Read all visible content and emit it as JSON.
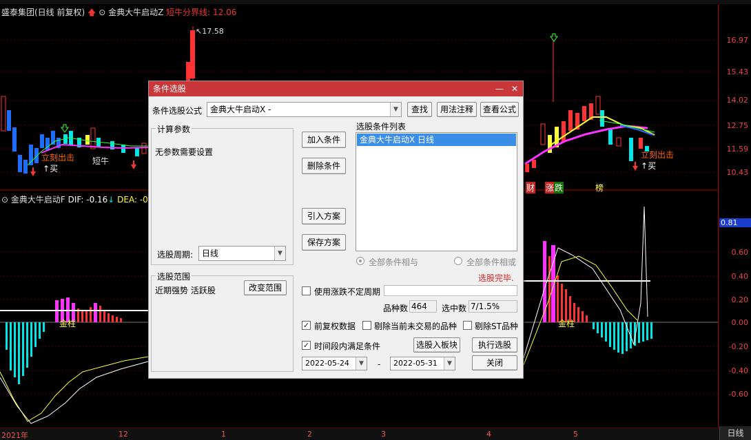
{
  "chart": {
    "stock_title": "盛泰集团(日线 前复权)",
    "indicator_main": "金典大牛启动Z",
    "bull_line_label": "短牛分界线: 12.06",
    "price_axis": [
      "16.97",
      "15.43",
      "14.02",
      "12.75",
      "11.59",
      "10.43"
    ],
    "high_marker": "17.58",
    "sub_axis": [
      "0.81",
      "0.60",
      "0.40",
      "0.20",
      "0.00",
      "-0.20",
      "-0.40",
      "-0.60"
    ],
    "sub_indicator": "金典大牛启动F",
    "dif_label": "DIF: -0.16",
    "dea_label": "DEA: -0.",
    "time_axis": [
      "2021年",
      "12",
      "1",
      "2",
      "3",
      "4",
      "5"
    ],
    "period_button": "日线",
    "annotations": {
      "out_left": "立刻出击",
      "buy_left": "买",
      "short_bull": "短牛",
      "out_right": "立刻出击",
      "buy_right": "买",
      "cai": "财",
      "zhang": "涨",
      "die": "跌",
      "bang": "榜",
      "gold_pillar_left": "金柱",
      "gold_pillar_right": "金柱"
    },
    "colors": {
      "up": "#ff3333",
      "down": "#00e5e5",
      "bull": "#ffff33",
      "magenta": "#ff33ff",
      "axis": "#ee3333"
    }
  },
  "dialog": {
    "title": "条件选股",
    "formula_label": "条件选股公式",
    "formula_value": "金典大牛启动X -",
    "btn_find": "查找",
    "btn_usage": "用法注释",
    "btn_view": "查看公式",
    "params_group": "计算参数",
    "params_text": "无参数需要设置",
    "period_label": "选股周期:",
    "period_value": "日线",
    "btn_add": "加入条件",
    "btn_delete": "删除条件",
    "btn_import": "引入方案",
    "btn_save": "保存方案",
    "cond_list_label": "选股条件列表",
    "cond_items": [
      "金典大牛启动X  日线"
    ],
    "radio_and": "全部条件相与",
    "radio_or": "全部条件相或",
    "status": "选股完毕.",
    "scope_group": "选股范围",
    "scope_text": "近期强势 活跃股",
    "btn_change_scope": "改变范围",
    "chk_unfixed": "使用涨跌不定周期",
    "count_label": "品种数",
    "count_value": "464",
    "selected_label": "选中数",
    "selected_value": "7/1.5%",
    "chk_adjust": "前复权数据",
    "chk_exclude_suspended": "剔除当前未交易的品种",
    "chk_exclude_st": "剔除ST品种",
    "chk_timerange": "时间段内满足条件",
    "btn_to_board": "选股入板块",
    "btn_execute": "执行选股",
    "date_from": "2022-05-24",
    "date_sep": "-",
    "date_to": "2022-05-31",
    "btn_close": "关闭"
  }
}
